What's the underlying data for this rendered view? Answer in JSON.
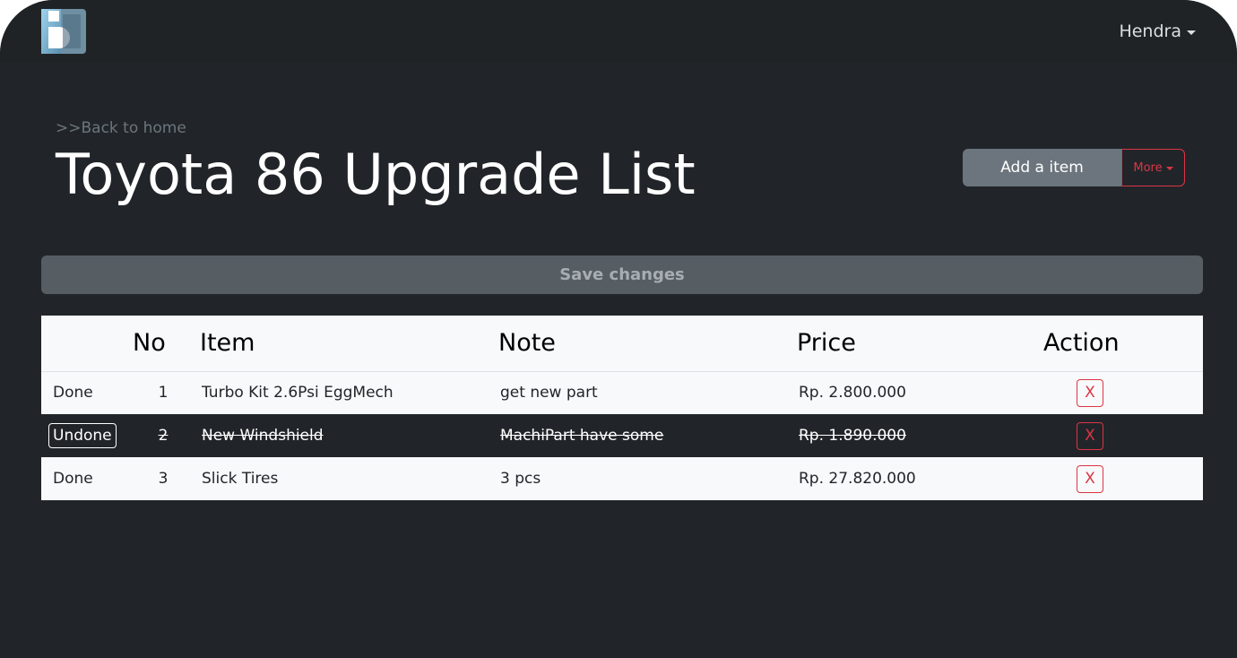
{
  "header": {
    "user_name": "Hendra"
  },
  "page": {
    "back_link": ">>Back to home",
    "title": "Toyota 86 Upgrade List",
    "add_button": "Add a item",
    "more_button": "More",
    "save_button": "Save changes"
  },
  "table": {
    "headers": {
      "status": "",
      "no": "No",
      "item": "Item",
      "note": "Note",
      "price": "Price",
      "action": "Action"
    },
    "rows": [
      {
        "status": "Done",
        "no": "1",
        "item": "Turbo Kit 2.6Psi EggMech",
        "note": "get new part",
        "price": "Rp. 2.800.000",
        "action": "X"
      },
      {
        "status": "Undone",
        "no": "2",
        "item": "New Windshield",
        "note": "MachiPart have some",
        "price": "Rp. 1.890.000",
        "action": "X"
      },
      {
        "status": "Done",
        "no": "3",
        "item": "Slick Tires",
        "note": "3 pcs",
        "price": "Rp. 27.820.000",
        "action": "X"
      }
    ]
  },
  "colors": {
    "background": "#212529",
    "danger": "#dc3545",
    "secondary": "#6c757d",
    "light": "#f8f9fa"
  }
}
